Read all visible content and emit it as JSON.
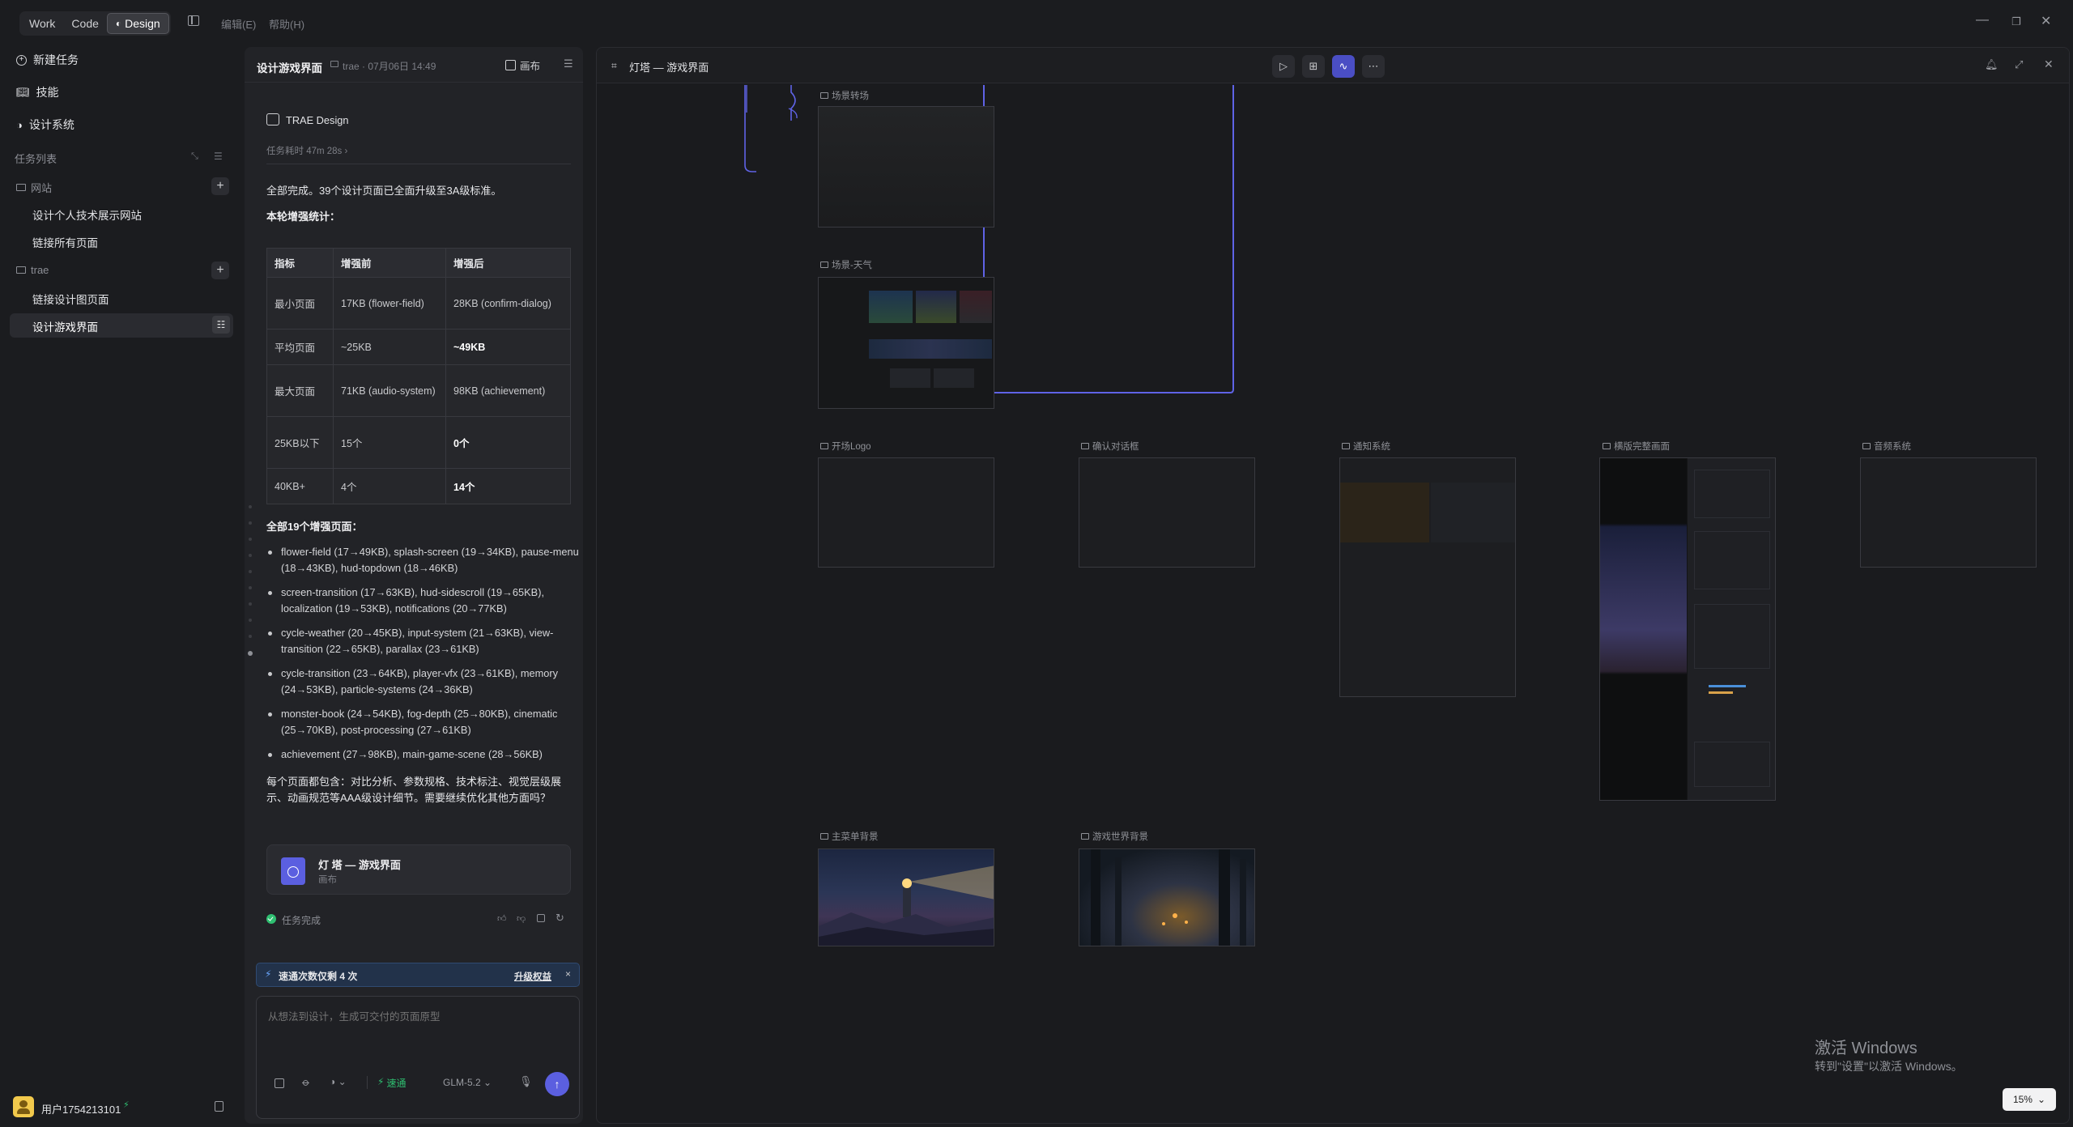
{
  "titlebar": {
    "modes": [
      "Work",
      "Code",
      "Design"
    ],
    "active_mode": "Design",
    "menu_edit": "编辑(E)",
    "menu_help": "帮助(H)"
  },
  "sidebar": {
    "new_task": "新建任务",
    "skills": "技能",
    "design_system": "设计系统",
    "task_list": "任务列表",
    "groups": [
      {
        "name": "网站",
        "items": [
          "设计个人技术展示网站",
          "链接所有页面"
        ]
      },
      {
        "name": "trae",
        "items": [
          "链接设计图页面",
          "设计游戏界面"
        ]
      }
    ],
    "user": "用户1754213101"
  },
  "chat": {
    "title": "设计游戏界面",
    "meta": "trae · 07月06日 14:49",
    "canvas_btn": "画布",
    "agent_name": "TRAE Design",
    "duration": "任务耗时 47m 28s",
    "summary": "全部完成。39个设计页面已全面升级至3A级标准。",
    "stats_title": "本轮增强统计：",
    "table": {
      "headers": [
        "指标",
        "增强前",
        "增强后"
      ],
      "rows": [
        [
          "最小页面",
          "17KB (flower-field)",
          "28KB (confirm-dialog)"
        ],
        [
          "平均页面",
          "~25KB",
          "~49KB"
        ],
        [
          "最大页面",
          "71KB (audio-system)",
          "98KB (achievement)"
        ],
        [
          "25KB以下",
          "15个",
          "0个"
        ],
        [
          "40KB+",
          "4个",
          "14个"
        ]
      ]
    },
    "enhanced_title": "全部19个增强页面：",
    "bullets": [
      "flower-field (17→49KB), splash-screen (19→34KB), pause-menu (18→43KB), hud-topdown (18→46KB)",
      "screen-transition (17→63KB), hud-sidescroll (19→65KB), localization (19→53KB), notifications (20→77KB)",
      "cycle-weather (20→45KB), input-system (21→63KB), view-transition (22→65KB), parallax (23→61KB)",
      "cycle-transition (23→64KB), player-vfx (23→61KB), memory (24→53KB), particle-systems (24→36KB)",
      "monster-book (24→54KB), fog-depth (25→80KB), cinematic (25→70KB), post-processing (27→61KB)",
      "achievement (27→98KB), main-game-scene (28→56KB)"
    ],
    "closing": "每个页面都包含：对比分析、参数规格、技术标注、视觉层级展示、动画规范等AAA级设计细节。需要继续优化其他方面吗？",
    "card_title": "灯 塔 — 游戏界面",
    "card_sub": "画布",
    "status": "任务完成",
    "promo_text": "速通次数仅剩 4 次",
    "promo_link": "升级权益",
    "input_placeholder": "从想法到设计，生成可交付的页面原型",
    "speed_mode": "速通",
    "model": "GLM-5.2"
  },
  "canvas": {
    "title": "灯塔 — 游戏界面",
    "frames": [
      "场景转场",
      "场景-天气",
      "开场Logo",
      "确认对话框",
      "通知系统",
      "横版完整画面",
      "音频系统",
      "主菜单背景",
      "游戏世界背景"
    ],
    "zoom": "15%"
  },
  "watermark": {
    "line1": "激活 Windows",
    "line2": "转到\"设置\"以激活 Windows。"
  },
  "colors": {
    "accent": "#5b5fe0",
    "link_line": "#5f63e6",
    "success": "#2fbf71",
    "promo_bg": "#22324a"
  }
}
